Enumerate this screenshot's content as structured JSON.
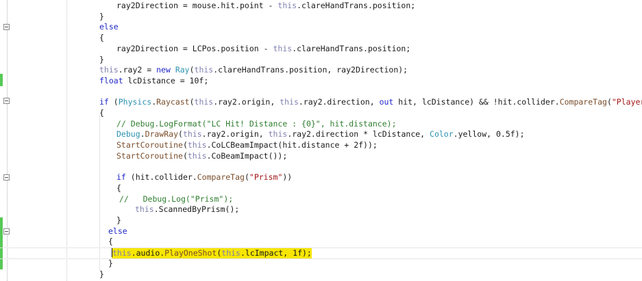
{
  "editor": {
    "lines": [
      "ray2Direction = mouse.hit.point - this.clareHandTrans.position;",
      "}",
      "else",
      "{",
      "ray2Direction = LCPos.position - this.clareHandTrans.position;",
      "}",
      "this.ray2 = new Ray(this.clareHandTrans.position, ray2Direction);",
      "float lcDistance = 10f;",
      "",
      "if (Physics.Raycast(this.ray2.origin, this.ray2.direction, out hit, lcDistance) && !hit.collider.CompareTag(\"Player\"))",
      "{",
      "// Debug.LogFormat(\"LC Hit! Distance : {0}\", hit.distance);",
      "Debug.DrawRay(this.ray2.origin, this.ray2.direction * lcDistance, Color.yellow, 0.5f);",
      "StartCoroutine(this.CoLCBeamImpact(hit.distance + 2f));",
      "StartCoroutine(this.CoBeamImpact());",
      "",
      "if (hit.collider.CompareTag(\"Prism\"))",
      "{",
      "//   Debug.Log(\"Prism\");",
      "this.ScannedByPrism();",
      "}",
      "else",
      "{",
      "this.audio.PlayOneShot(this.lcImpact, 1f);",
      "}",
      "}"
    ],
    "colors": {
      "keyword": "#1f27c8",
      "this": "#8080b0",
      "type": "#2b91af",
      "method": "#7a4d2a",
      "string": "#a31515",
      "comment": "#2f7d2f",
      "highlight": "#f7e600",
      "change_bar": "#57c957"
    }
  }
}
